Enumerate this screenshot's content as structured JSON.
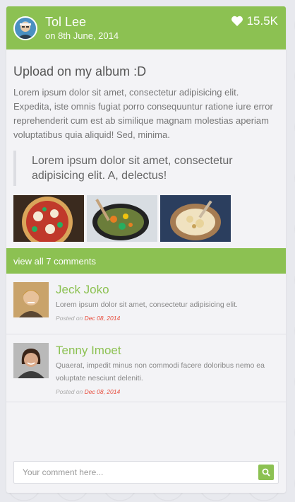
{
  "colors": {
    "accent": "#8cc152",
    "date_red": "#e74c3c",
    "background": "#e8e9ee"
  },
  "post": {
    "author": "Tol Lee",
    "date": "on 8th June, 2014",
    "likes": "15.5K",
    "like_icon": "heart-icon",
    "title": "Upload on my album :D",
    "text": "Lorem ipsum dolor sit amet, consectetur adipisicing elit. Expedita, iste omnis fugiat porro consequuntur ratione iure error reprehenderit cum est ab similique magnam molestias aperiam voluptatibus quia aliquid! Sed, minima.",
    "quote": "Lorem ipsum dolor sit amet, consectetur adipisicing elit. A, delectus!",
    "photos": [
      "pizza-photo",
      "pan-vegetables-photo",
      "bowl-dish-photo"
    ]
  },
  "comments_link": "view all 7 comments",
  "comments": [
    {
      "name": "Jeck Joko",
      "text": "Lorem ipsum dolor sit amet, consectetur adipisicing elit.",
      "posted_label": "Posted on",
      "date": "Dec 08, 2014"
    },
    {
      "name": "Tenny Imoet",
      "text": "Quaerat, impedit minus non commodi facere doloribus nemo ea voluptate nesciunt deleniti.",
      "posted_label": "Posted on",
      "date": "Dec 08, 2014"
    }
  ],
  "comment_form": {
    "placeholder": "Your comment here...",
    "submit_icon": "search-icon"
  }
}
